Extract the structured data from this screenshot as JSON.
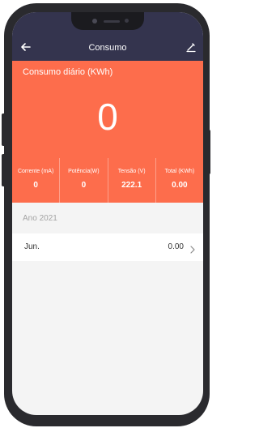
{
  "colors": {
    "navbar": "#34344e",
    "hero": "#fd6d4c",
    "background": "#f4f4f4",
    "year_text": "#a4a4a4"
  },
  "navbar": {
    "title": "Consumo",
    "back_icon": "back-arrow-icon",
    "edit_icon": "pencil-icon"
  },
  "hero": {
    "label": "Consumo diário (KWh)",
    "value": "0"
  },
  "stats": [
    {
      "label": "Corrente (mA)",
      "value": "0"
    },
    {
      "label": "Potência(W)",
      "value": "0"
    },
    {
      "label": "Tensão (V)",
      "value": "222.1"
    },
    {
      "label": "Total (KWh)",
      "value": "0.00"
    }
  ],
  "history": {
    "year_label": "Ano 2021",
    "rows": [
      {
        "month": "Jun.",
        "value": "0.00",
        "icon": "chevron-right-icon"
      }
    ]
  }
}
